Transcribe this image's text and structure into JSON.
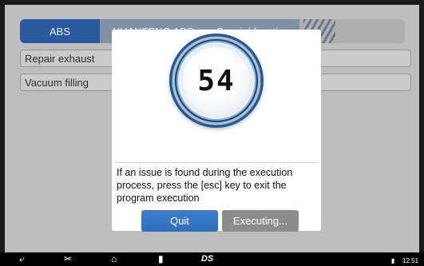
{
  "breadcrumb": {
    "items": [
      "ABS",
      "YUANFENG ABS",
      "Special function"
    ]
  },
  "functions": [
    {
      "label": "Repair exhaust"
    },
    {
      "label": "Vacuum filling"
    }
  ],
  "dialog": {
    "countdown": "54",
    "message": "If an issue is found during the execution process, press the [esc] key to exit the program execution",
    "quit_label": "Quit",
    "executing_label": "Executing..."
  },
  "taskbar": {
    "time": "12:51",
    "logo": "DS"
  },
  "colors": {
    "accent": "#2d5ea8",
    "button_blue": "#3a7fd1",
    "button_gray": "#8c8c8c"
  }
}
